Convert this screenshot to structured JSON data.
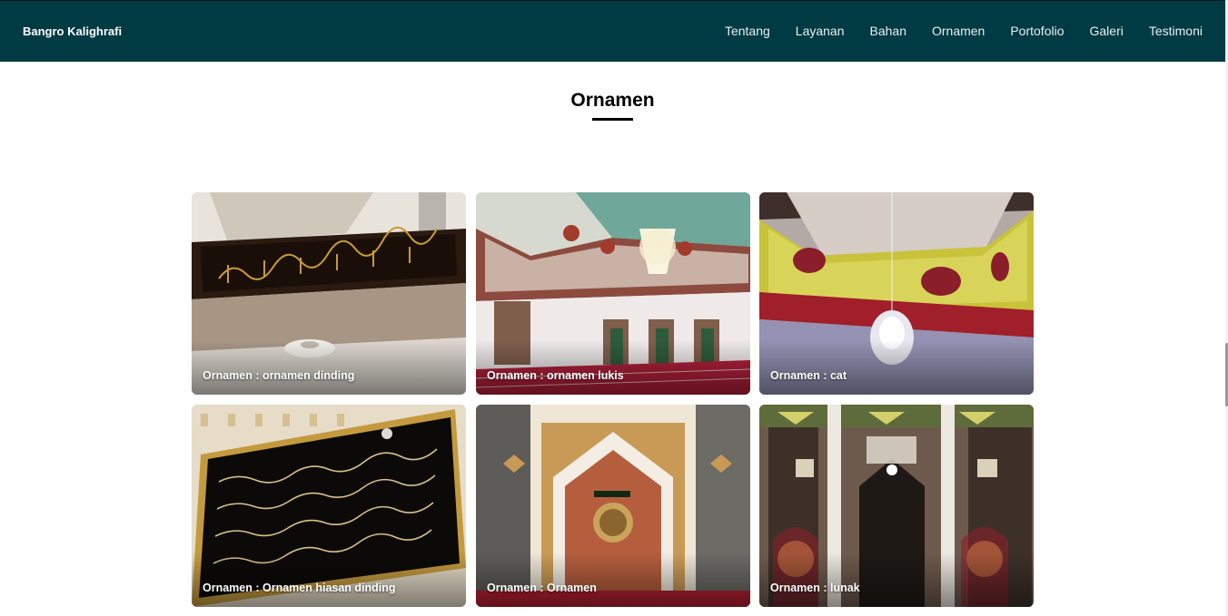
{
  "navbar": {
    "brand": "Bangro Kalighrafi",
    "links": [
      "Tentang",
      "Layanan",
      "Bahan",
      "Ornamen",
      "Portofolio",
      "Galeri",
      "Testimoni"
    ]
  },
  "section": {
    "title": "Ornamen"
  },
  "gallery": [
    {
      "caption": "Ornamen : ornamen dinding"
    },
    {
      "caption": "Ornamen : ornamen lukis"
    },
    {
      "caption": "Ornamen : cat"
    },
    {
      "caption": "Ornamen : Ornamen hiasan dinding"
    },
    {
      "caption": "Ornamen : Ornamen"
    },
    {
      "caption": "Ornamen : lunak"
    }
  ]
}
